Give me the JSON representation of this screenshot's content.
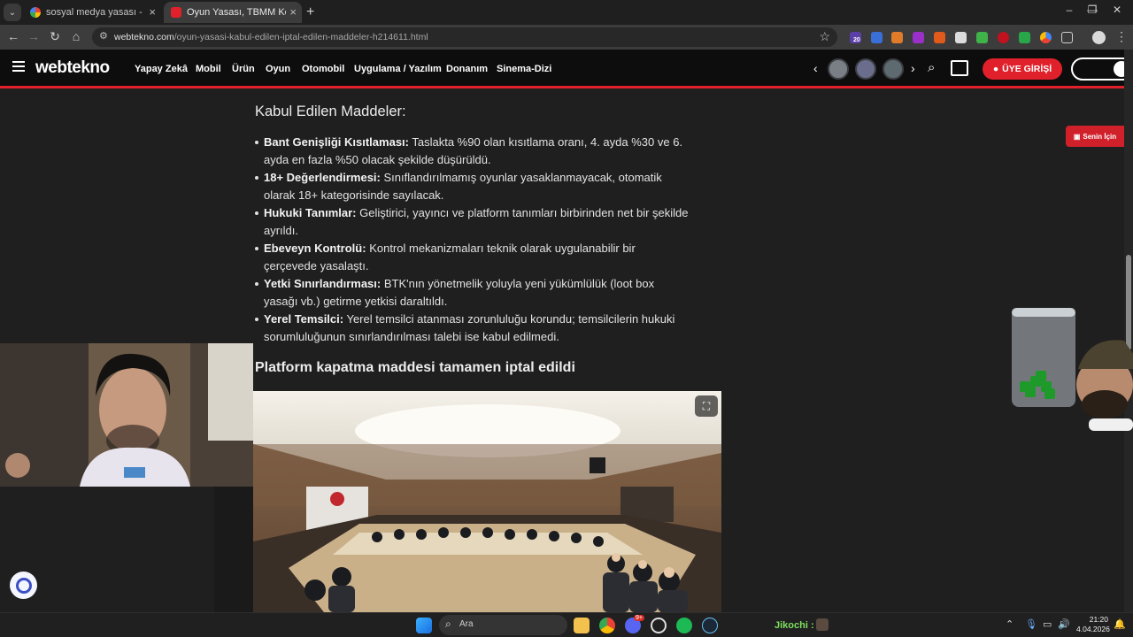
{
  "browser": {
    "tabs": [
      {
        "title": "sosyal medya yasası - Google'd",
        "active": false
      },
      {
        "title": "Oyun Yasası, TBMM Komisyonu",
        "active": true
      }
    ],
    "new_tab_label": "+",
    "url_host": "webtekno.com",
    "url_path": "/oyun-yasasi-kabul-edilen-iptal-edilen-maddeler-h214611.html",
    "extension_badge": "20"
  },
  "site": {
    "logo": "webtekno",
    "nav": [
      "Yapay Zekâ",
      "Mobil",
      "Ürün",
      "Oyun",
      "Otomobil",
      "Uygulama / Yazılım",
      "Donanım",
      "Sinema-Dizi"
    ],
    "login_label": "ÜYE GİRİŞİ",
    "for_you_label": "Senin İçin",
    "accent_color": "#e0212b"
  },
  "article": {
    "heading_accepted": "Kabul Edilen Maddeler:",
    "items": [
      {
        "label": "Bant Genişliği Kısıtlaması:",
        "text": " Taslakta %90 olan kısıtlama oranı, 4. ayda %30 ve 6. ayda en fazla %50 olacak şekilde düşürüldü."
      },
      {
        "label": "18+ Değerlendirmesi:",
        "text": " Sınıflandırılmamış oyunlar yasaklanmayacak, otomatik olarak 18+ kategorisinde sayılacak."
      },
      {
        "label": "Hukuki Tanımlar:",
        "text": " Geliştirici, yayıncı ve platform tanımları birbirinden net bir şekilde ayrıldı."
      },
      {
        "label": "Ebeveyn Kontrolü:",
        "text": " Kontrol mekanizmaları teknik olarak uygulanabilir bir çerçevede yasalaştı."
      },
      {
        "label": "Yetki Sınırlandırması:",
        "text": " BTK'nın yönetmelik yoluyla yeni yükümlülük (loot box yasağı vb.) getirme yetkisi daraltıldı."
      },
      {
        "label": "Yerel Temsilci:",
        "text": " Yerel temsilci atanması zorunluluğu korundu; temsilcilerin hukuki sorumluluğunun sınırlandırılması talebi ise kabul edilmedi."
      }
    ],
    "heading_platform": "Platform kapatma maddesi tamamen iptal edildi"
  },
  "taskbar": {
    "search_label": "Ara",
    "chat_user": "Jikochi :",
    "time": "21:20",
    "date": "4.04.2026",
    "discord_badge": "9+"
  }
}
